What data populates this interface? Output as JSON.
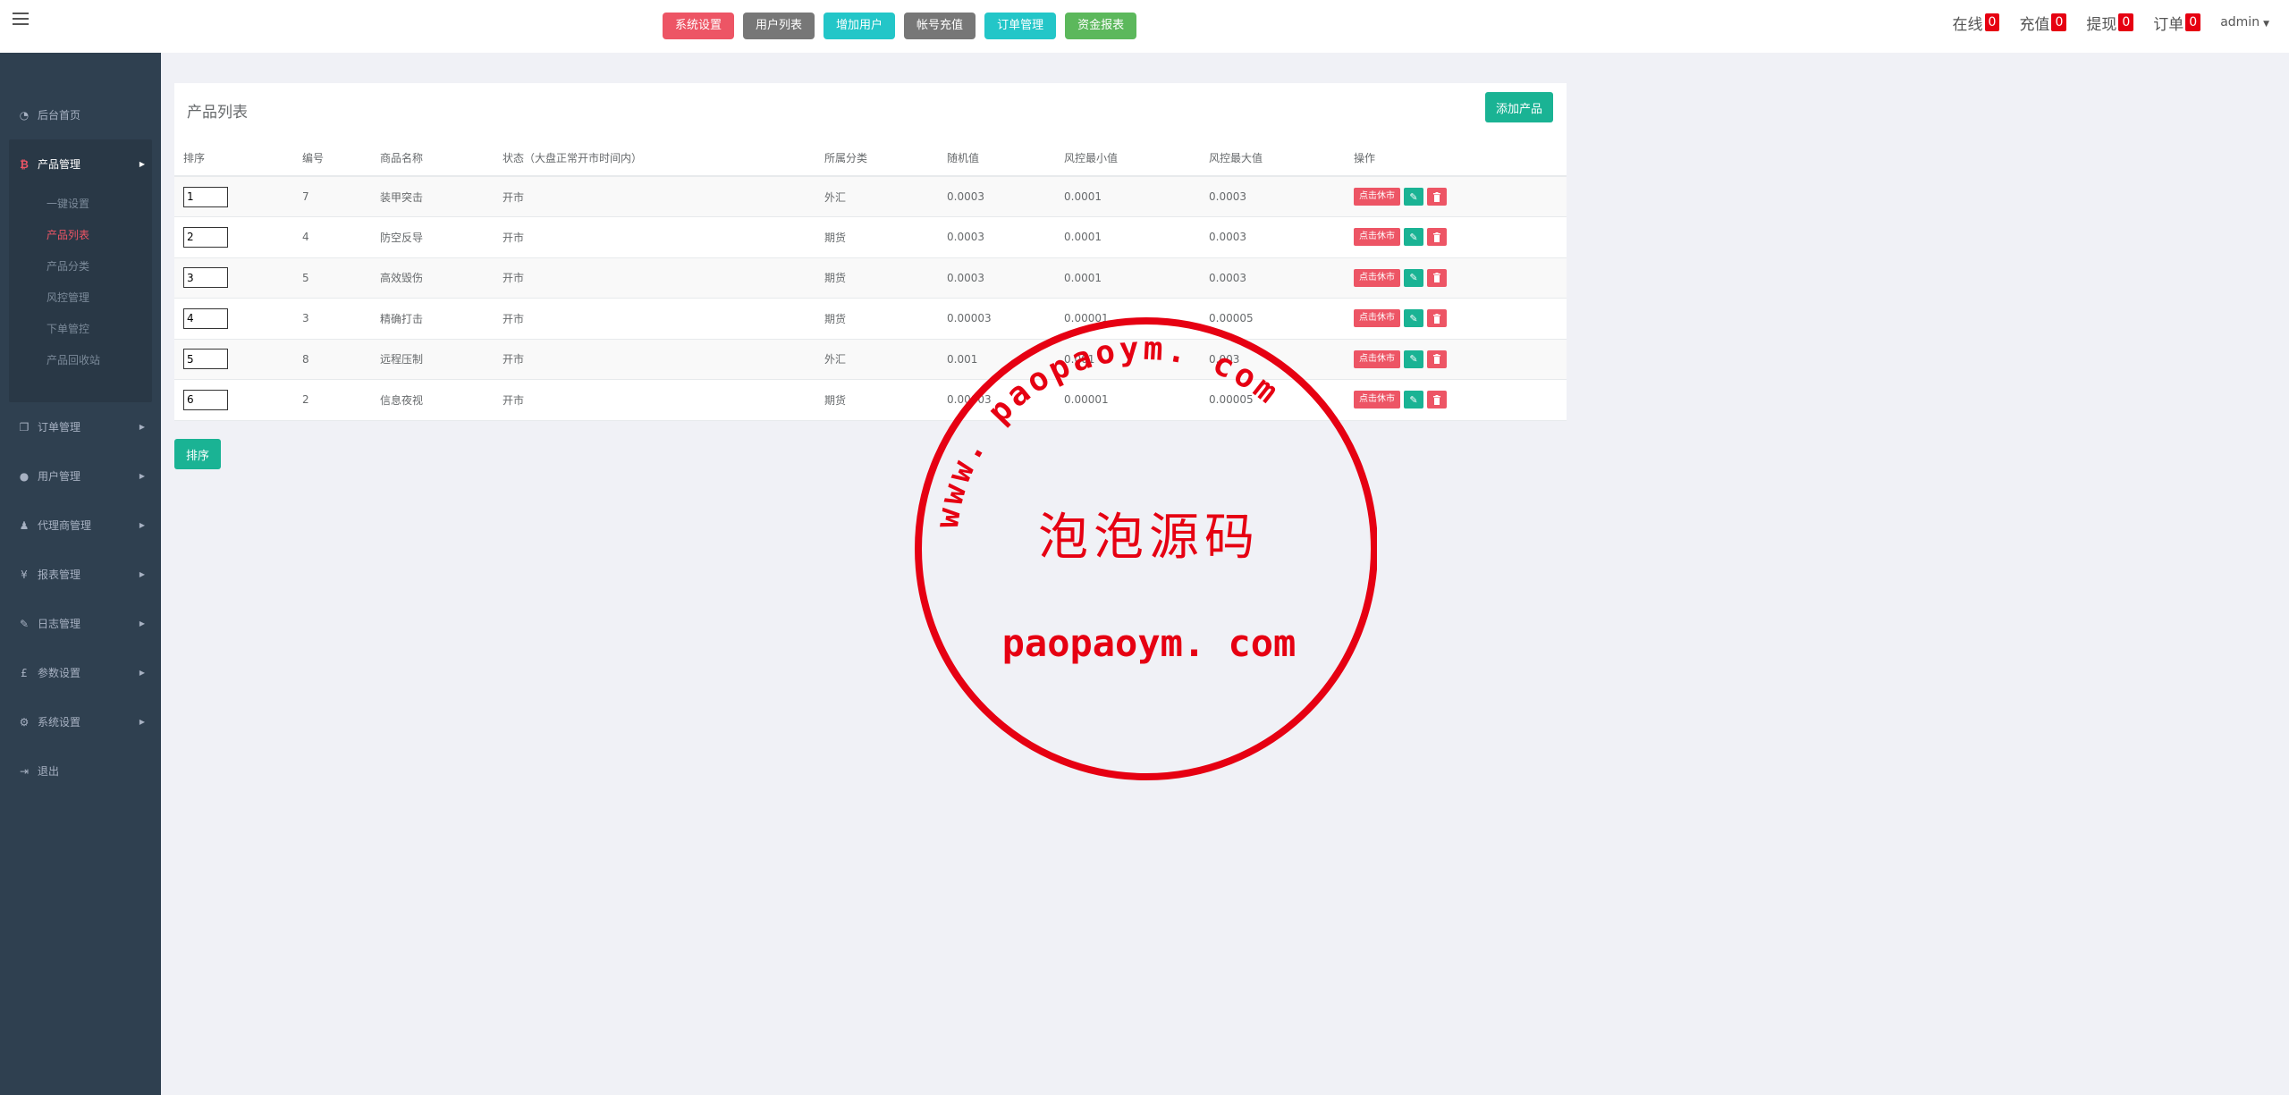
{
  "topbar": {
    "buttons": [
      {
        "label": "系统设置",
        "color": "#ed5565"
      },
      {
        "label": "用户列表",
        "color": "#777777"
      },
      {
        "label": "增加用户",
        "color": "#23c6c8"
      },
      {
        "label": "帐号充值",
        "color": "#777777"
      },
      {
        "label": "订单管理",
        "color": "#23c6c8"
      },
      {
        "label": "资金报表",
        "color": "#5cb85c"
      }
    ],
    "stats": [
      {
        "label": "在线",
        "count": "0"
      },
      {
        "label": "充值",
        "count": "0"
      },
      {
        "label": "提现",
        "count": "0"
      },
      {
        "label": "订单",
        "count": "0"
      }
    ],
    "user": "admin"
  },
  "sidebar": {
    "home": {
      "label": "后台首页",
      "icon": "dashboard-icon"
    },
    "active": {
      "label": "产品管理",
      "icon": "bitcoin-icon",
      "children": [
        "一键设置",
        "产品列表",
        "产品分类",
        "风控管理",
        "下单管控",
        "产品回收站"
      ],
      "current": "产品列表"
    },
    "items": [
      {
        "label": "订单管理",
        "icon": "copy-icon",
        "glyph": "❐"
      },
      {
        "label": "用户管理",
        "icon": "user-icon",
        "glyph": "●"
      },
      {
        "label": "代理商管理",
        "icon": "user-md-icon",
        "glyph": "♟"
      },
      {
        "label": "报表管理",
        "icon": "yen-icon",
        "glyph": "¥"
      },
      {
        "label": "日志管理",
        "icon": "ticket-icon",
        "glyph": "✎"
      },
      {
        "label": "参数设置",
        "icon": "gbp-icon",
        "glyph": "£"
      },
      {
        "label": "系统设置",
        "icon": "gears-icon",
        "glyph": "⚙"
      }
    ],
    "logout": {
      "label": "退出",
      "icon": "sign-out-icon"
    }
  },
  "panel": {
    "title": "产品列表",
    "add_label": "添加产品",
    "sort_label": "排序",
    "columns": [
      "排序",
      "编号",
      "商品名称",
      "状态（大盘正常开市时间内）",
      "所属分类",
      "随机值",
      "风控最小值",
      "风控最大值",
      "操作"
    ],
    "rows": [
      {
        "sort": "1",
        "id": "7",
        "name": "装甲突击",
        "status": "开市",
        "category": "外汇",
        "random": "0.0003",
        "min": "0.0001",
        "max": "0.0003"
      },
      {
        "sort": "2",
        "id": "4",
        "name": "防空反导",
        "status": "开市",
        "category": "期货",
        "random": "0.0003",
        "min": "0.0001",
        "max": "0.0003"
      },
      {
        "sort": "3",
        "id": "5",
        "name": "高效毁伤",
        "status": "开市",
        "category": "期货",
        "random": "0.0003",
        "min": "0.0001",
        "max": "0.0003"
      },
      {
        "sort": "4",
        "id": "3",
        "name": "精确打击",
        "status": "开市",
        "category": "期货",
        "random": "0.00003",
        "min": "0.00001",
        "max": "0.00005"
      },
      {
        "sort": "5",
        "id": "8",
        "name": "远程压制",
        "status": "开市",
        "category": "外汇",
        "random": "0.001",
        "min": "0.001",
        "max": "0.003"
      },
      {
        "sort": "6",
        "id": "2",
        "name": "信息夜视",
        "status": "开市",
        "category": "期货",
        "random": "0.00003",
        "min": "0.00001",
        "max": "0.00005"
      }
    ],
    "action_label": "点击休市"
  },
  "watermark": {
    "url_arc": "www. paopaoym. com",
    "title": "泡泡源码",
    "domain": "paopaoym. com",
    "color": "#e60012"
  }
}
